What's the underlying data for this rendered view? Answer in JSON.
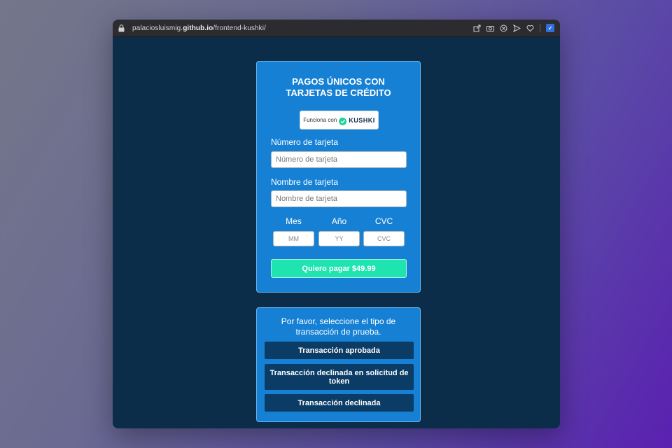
{
  "browser": {
    "url_host_prefix": "palaciosluismig.",
    "url_host_domain": "github.io",
    "url_path": "/frontend-kushki/",
    "toolbar_icons": [
      "share-icon",
      "camera-icon",
      "block-icon",
      "send-icon",
      "heart-icon",
      "extension-icon"
    ]
  },
  "payment_card": {
    "title": "PAGOS ÚNICOS CON TARJETAS DE CRÉDITO",
    "badge_prefix": "Funciona con",
    "badge_brand": "KUSHKI",
    "card_number": {
      "label": "Número de tarjeta",
      "placeholder": "Número de tarjeta",
      "value": ""
    },
    "card_name": {
      "label": "Nombre de tarjeta",
      "placeholder": "Nombre de tarjeta",
      "value": ""
    },
    "month": {
      "label": "Mes",
      "placeholder": "MM"
    },
    "year": {
      "label": "Año",
      "placeholder": "YY"
    },
    "cvc": {
      "label": "CVC",
      "placeholder": "CVC"
    },
    "pay_button": "Quiero pagar $49.99"
  },
  "test_card": {
    "info": "Por favor, seleccione el tipo de transacción de prueba.",
    "buttons": [
      "Transacción aprobada",
      "Transacción declinada en solicitud de token",
      "Transacción declinada"
    ]
  },
  "colors": {
    "page_bg": "#0b2d4a",
    "card_bg": "#1681d4",
    "pay_button": "#1fe4b0",
    "tx_button": "#0b3c66"
  }
}
